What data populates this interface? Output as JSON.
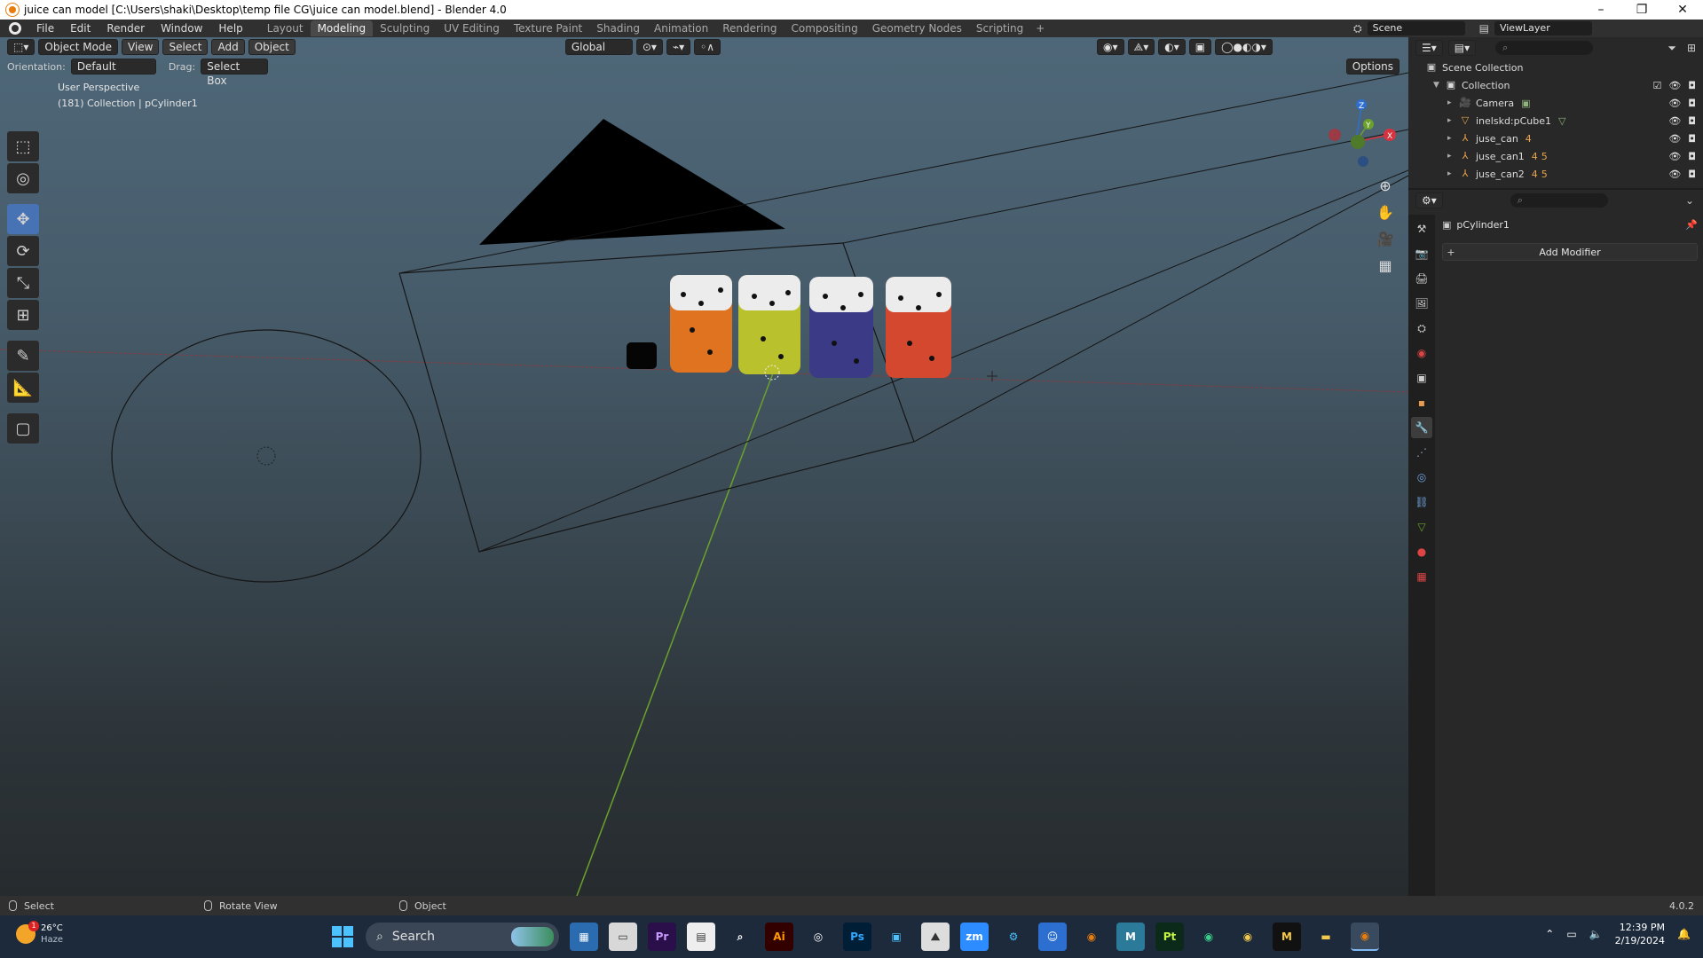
{
  "window": {
    "title": "juice can model [C:\\Users\\shaki\\Desktop\\temp file CG\\juice can model.blend] - Blender 4.0",
    "controls": [
      "–",
      "❐",
      "✕"
    ]
  },
  "menu": [
    "File",
    "Edit",
    "Render",
    "Window",
    "Help"
  ],
  "workspaces": [
    "Layout",
    "Modeling",
    "Sculpting",
    "UV Editing",
    "Texture Paint",
    "Shading",
    "Animation",
    "Rendering",
    "Compositing",
    "Geometry Nodes",
    "Scripting"
  ],
  "active_workspace_index": 1,
  "scene_selector": {
    "scene": "Scene",
    "view_layer": "ViewLayer"
  },
  "viewport": {
    "mode": "Object Mode",
    "menus": [
      "View",
      "Select",
      "Add",
      "Object"
    ],
    "transform_orientation": "Global",
    "orientation_label": "Orientation:",
    "orientation_value": "Default",
    "drag_label": "Drag:",
    "drag_value": "Select Box",
    "options_label": "Options",
    "overlay_line1": "User Perspective",
    "overlay_line2": "(181) Collection | pCylinder1",
    "gizmo_axes": {
      "x": "X",
      "y": "Y",
      "z": "Z"
    }
  },
  "tools": [
    "select-box",
    "cursor",
    "move",
    "rotate",
    "scale",
    "transform",
    "annotate",
    "measure",
    "add-cube"
  ],
  "active_tool_index": 2,
  "outliner": {
    "root": "Scene Collection",
    "collection": "Collection",
    "items": [
      {
        "name": "Camera",
        "icon": "camera-icon"
      },
      {
        "name": "inelskd:pCube1",
        "icon": "mesh-icon"
      },
      {
        "name": "juse_can",
        "icon": "empty-icon",
        "count": "4"
      },
      {
        "name": "juse_can1",
        "icon": "empty-icon",
        "count": "4",
        "count2": "5"
      },
      {
        "name": "juse_can2",
        "icon": "empty-icon",
        "count": "4",
        "count2": "5"
      }
    ]
  },
  "properties": {
    "object_name": "pCylinder1",
    "add_modifier_label": "Add Modifier"
  },
  "statusbar": {
    "select": "Select",
    "rotate": "Rotate View",
    "object": "Object",
    "version": "4.0.2"
  },
  "taskbar": {
    "weather_temp": "26°C",
    "weather_cond": "Haze",
    "notification_count": "1",
    "search_placeholder": "Search",
    "apps": [
      "Pr",
      "Ai",
      "Ps",
      "zm",
      "M",
      "Pt"
    ],
    "time": "12:39 PM",
    "date": "2/19/2024"
  },
  "colors": {
    "accent": "#4772b3",
    "blender_orange": "#e87d0d",
    "x_axis": "#d6333f",
    "y_axis": "#6aa12b",
    "z_axis": "#2e6fd0"
  }
}
